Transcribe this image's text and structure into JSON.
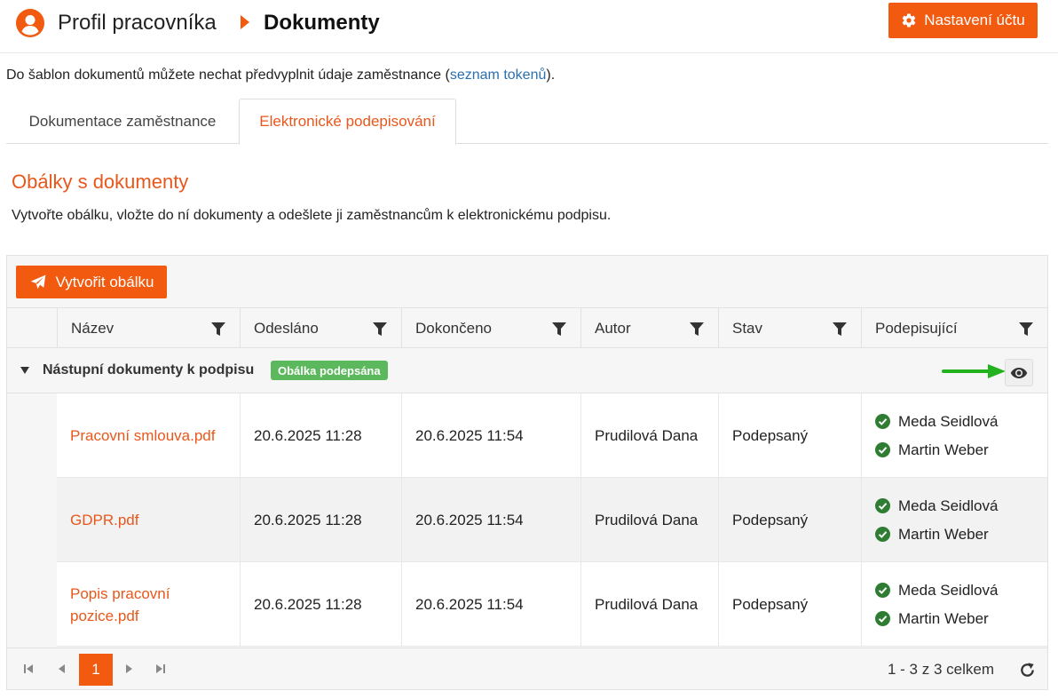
{
  "header": {
    "profile_label": "Profil pracovníka",
    "current_label": "Dokumenty",
    "settings_label": "Nastavení účtu"
  },
  "info": {
    "text_before": "Do šablon dokumentů můžete nechat předvyplnit údaje zaměstnance (",
    "link_label": "seznam tokenů",
    "text_after": ")."
  },
  "tabs": [
    {
      "label": "Dokumentace zaměstnance",
      "active": false
    },
    {
      "label": "Elektronické podepisování",
      "active": true
    }
  ],
  "section": {
    "title": "Obálky s dokumenty",
    "description": "Vytvořte obálku, vložte do ní dokumenty a odešlete ji zaměstnancům k elektronickému podpisu."
  },
  "grid": {
    "create_label": "Vytvořit obálku",
    "columns": [
      "Název",
      "Odesláno",
      "Dokončeno",
      "Autor",
      "Stav",
      "Podepisující"
    ],
    "group": {
      "title": "Nástupní dokumenty k podpisu",
      "badge": "Obálka podepsána"
    },
    "rows": [
      {
        "name": "Pracovní smlouva.pdf",
        "sent": "20.6.2025 11:28",
        "completed": "20.6.2025 11:54",
        "author": "Prudilová Dana",
        "status": "Podepsaný",
        "signers": [
          "Meda Seidlová",
          "Martin Weber"
        ]
      },
      {
        "name": "GDPR.pdf",
        "sent": "20.6.2025 11:28",
        "completed": "20.6.2025 11:54",
        "author": "Prudilová Dana",
        "status": "Podepsaný",
        "signers": [
          "Meda Seidlová",
          "Martin Weber"
        ]
      },
      {
        "name": "Popis pracovní pozice.pdf",
        "sent": "20.6.2025 11:28",
        "completed": "20.6.2025 11:54",
        "author": "Prudilová Dana",
        "status": "Podepsaný",
        "signers": [
          "Meda Seidlová",
          "Martin Weber"
        ]
      }
    ],
    "pager": {
      "current_page": "1",
      "info": "1 - 3 z 3 celkem"
    }
  },
  "colors": {
    "accent": "#f25a0f",
    "link": "#2a6fb0",
    "success": "#5cb85c",
    "check": "#2e7d32",
    "arrow": "#22b21e"
  }
}
